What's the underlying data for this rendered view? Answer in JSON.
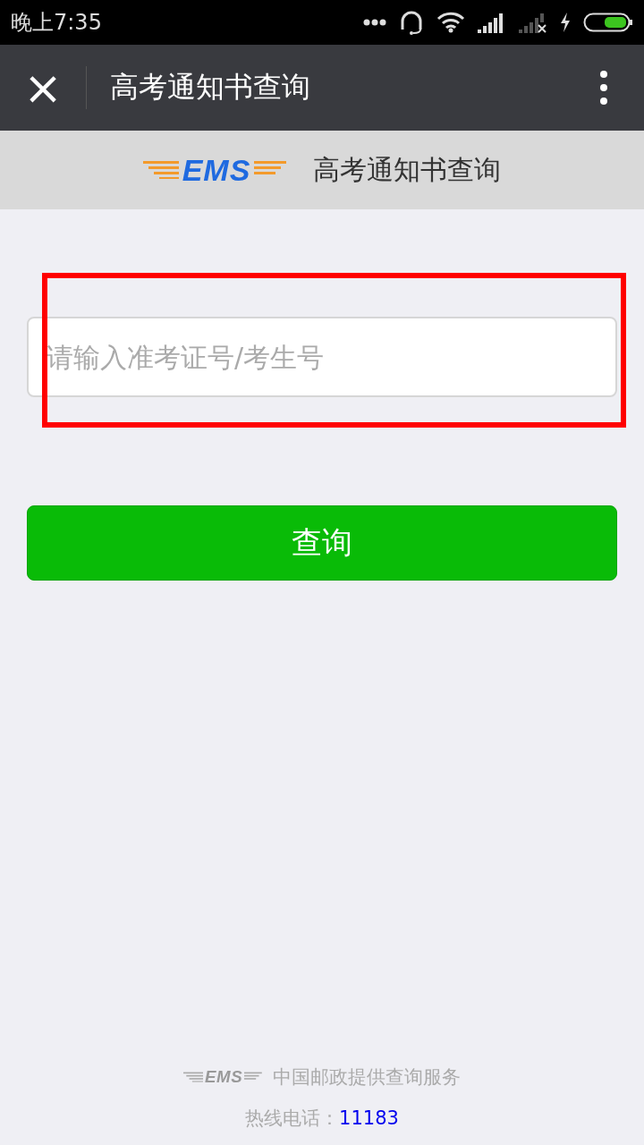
{
  "status_bar": {
    "time": "晚上7:35"
  },
  "nav_bar": {
    "close_icon": "×",
    "title": "高考通知书查询"
  },
  "banner": {
    "logo_text": "EMS",
    "title": "高考通知书查询"
  },
  "form": {
    "placeholder": "请输入准考证号/考生号",
    "button": "查询",
    "highlighted": true
  },
  "footer": {
    "logo_text": "EMS",
    "provider": "中国邮政提供查询服务",
    "hotline_label": "热线电话：",
    "hotline": "11183"
  }
}
